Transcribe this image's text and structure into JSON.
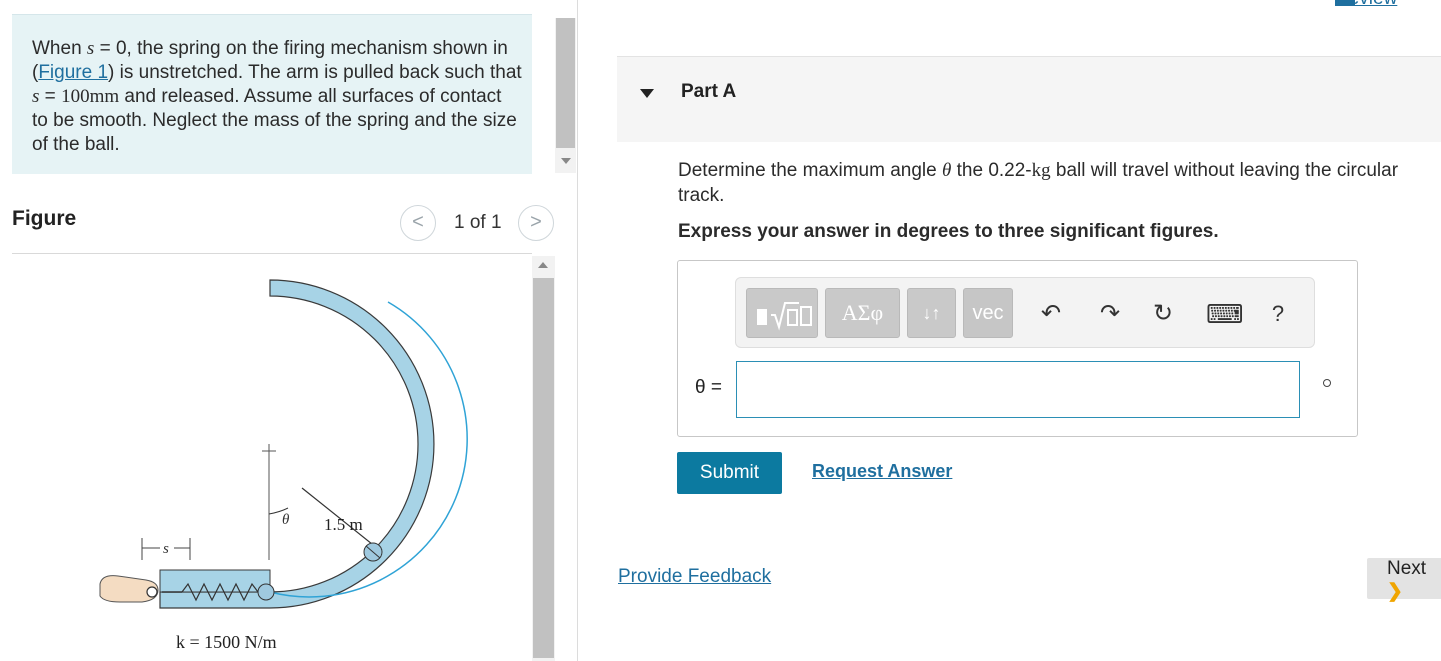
{
  "problem": {
    "t1": "When ",
    "s_sym": "s",
    "t2": " = 0, the spring on the firing mechanism shown in (",
    "figure_link": "Figure 1",
    "t3": ") is unstretched. The arm is pulled back such that ",
    "t4": " = ",
    "s_value": "100mm",
    "t5": " and released. Assume all surfaces of contact to be smooth. Neglect the mass of the spring and the size of the ball."
  },
  "figure": {
    "heading": "Figure",
    "prev_icon": "<",
    "next_icon": ">",
    "pager": "1 of 1",
    "label_radius": "1.5 m",
    "label_theta": "θ",
    "label_s": "s",
    "label_k": "k = 1500 N/m"
  },
  "header": {
    "review_link": "Review"
  },
  "part": {
    "title": "Part A",
    "question_a": "Determine the maximum angle ",
    "question_theta": "θ",
    "question_b": " the 0.22-",
    "question_kg": "kg",
    "question_c": " ball will travel without leaving the circular track.",
    "instruction": "Express your answer in degrees to three significant figures."
  },
  "toolbar": {
    "templates_icon": "templates-icon",
    "greek_label": "ΑΣφ",
    "arrows_label": "↓↑",
    "vec_label": "vec",
    "undo": "↶",
    "redo": "↷",
    "reset": "↻",
    "keyboard": "⌨",
    "help": "?"
  },
  "answer": {
    "label": "θ =",
    "value": "",
    "unit": "°"
  },
  "actions": {
    "submit": "Submit",
    "request_answer": "Request Answer",
    "feedback": "Provide Feedback",
    "next": "Next",
    "next_chevron": "❯"
  }
}
